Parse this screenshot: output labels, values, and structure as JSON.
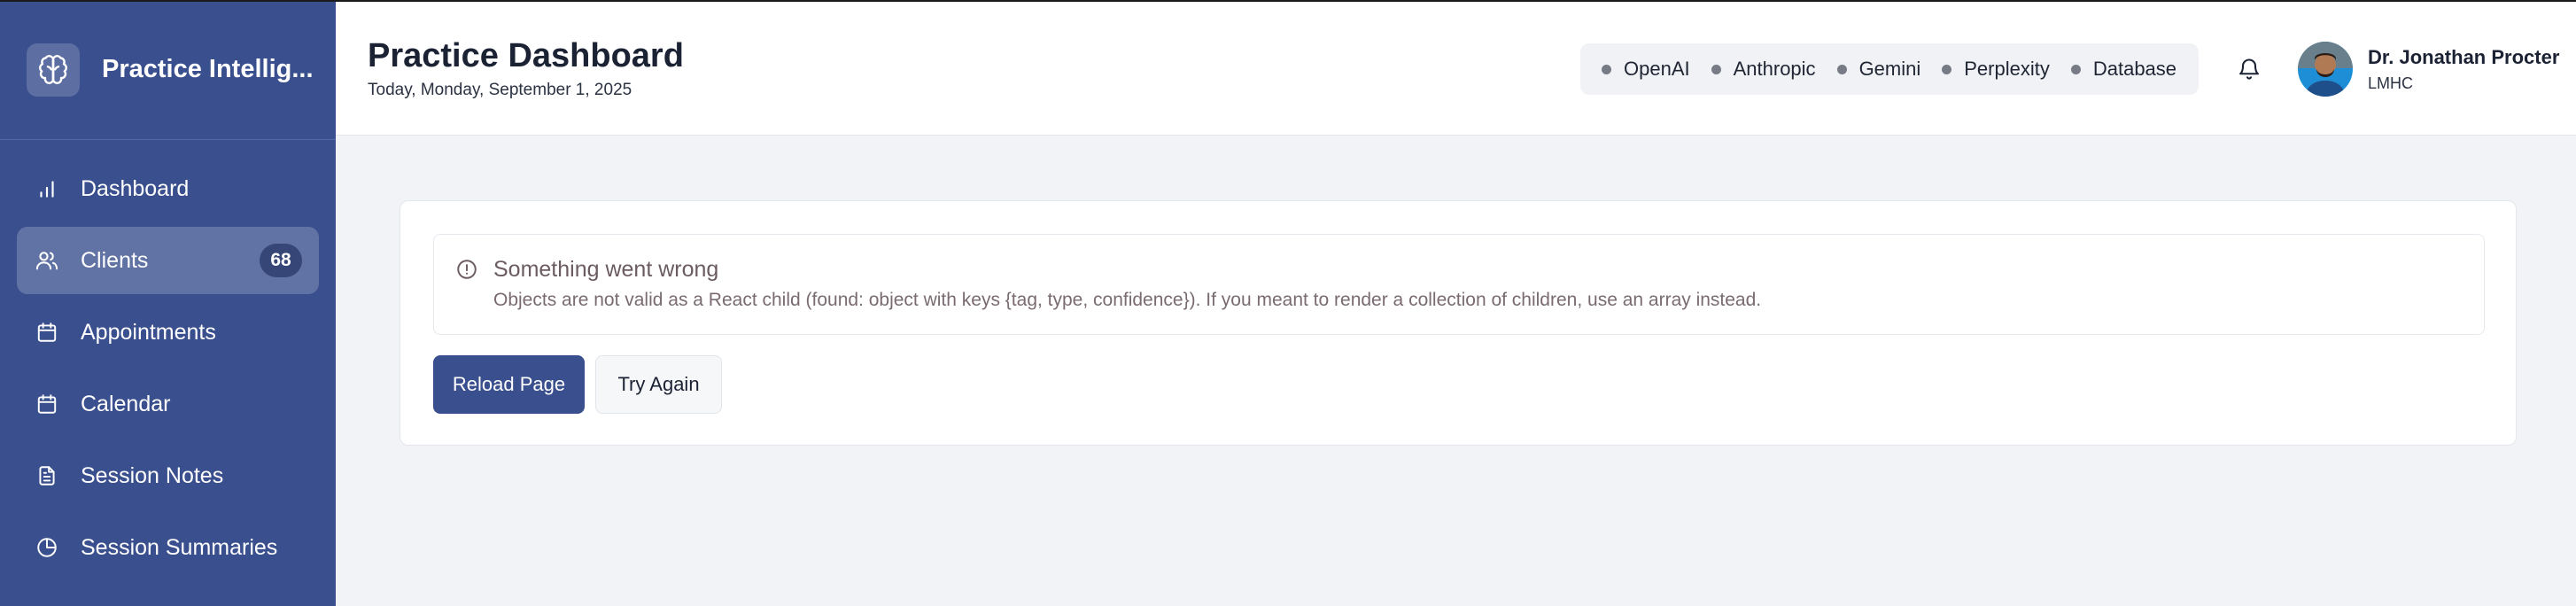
{
  "app": {
    "name": "Practice Intellig..."
  },
  "sidebar": {
    "items": [
      {
        "label": "Dashboard",
        "icon": "bar-chart-icon"
      },
      {
        "label": "Clients",
        "icon": "users-icon",
        "badge": "68",
        "active": true
      },
      {
        "label": "Appointments",
        "icon": "calendar-icon"
      },
      {
        "label": "Calendar",
        "icon": "calendar-icon"
      },
      {
        "label": "Session Notes",
        "icon": "document-icon"
      },
      {
        "label": "Session Summaries",
        "icon": "pie-chart-icon"
      }
    ]
  },
  "header": {
    "title": "Practice Dashboard",
    "date": "Today, Monday, September 1, 2025",
    "services": [
      "OpenAI",
      "Anthropic",
      "Gemini",
      "Perplexity",
      "Database"
    ],
    "user": {
      "name": "Dr. Jonathan Procter",
      "role": "LMHC"
    }
  },
  "error": {
    "title": "Something went wrong",
    "message": "Objects are not valid as a React child (found: object with keys {tag, type, confidence}). If you meant to render a collection of children, use an array instead.",
    "reload_label": "Reload Page",
    "try_again_label": "Try Again"
  },
  "colors": {
    "sidebar_bg": "#3a4f8e",
    "primary_button": "#3a4f8e",
    "status_dot": "#767b85",
    "error_text": "#6b5b62"
  }
}
